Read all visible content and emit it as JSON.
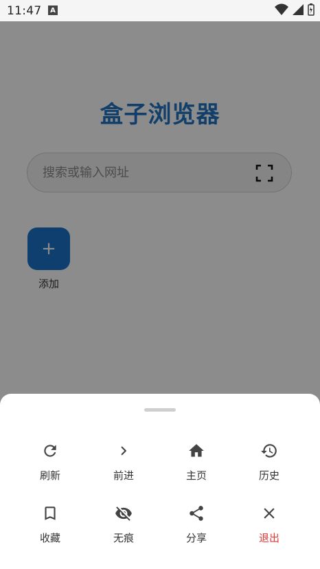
{
  "status_bar": {
    "time": "11:47",
    "notification_icon": "A"
  },
  "app": {
    "title": "盒子浏览器",
    "search": {
      "placeholder": "搜索或输入网址"
    },
    "shortcuts": [
      {
        "label": "添加",
        "icon": "+"
      }
    ]
  },
  "menu_sheet": {
    "row1": [
      {
        "label": "刷新",
        "icon": "refresh-icon"
      },
      {
        "label": "前进",
        "icon": "chevron-right-icon"
      },
      {
        "label": "主页",
        "icon": "home-icon"
      },
      {
        "label": "历史",
        "icon": "history-icon"
      }
    ],
    "row2": [
      {
        "label": "收藏",
        "icon": "bookmark-icon"
      },
      {
        "label": "无痕",
        "icon": "incognito-eye-icon"
      },
      {
        "label": "分享",
        "icon": "share-icon"
      },
      {
        "label": "退出",
        "icon": "close-icon"
      }
    ]
  },
  "colors": {
    "accent": "#1f73c1",
    "exit_red": "#e53935"
  }
}
